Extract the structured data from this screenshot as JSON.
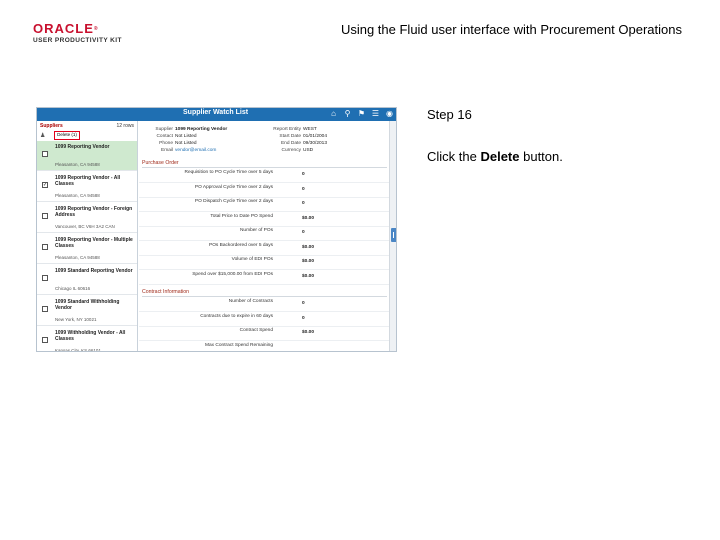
{
  "header": {
    "logo_word": "ORACLE",
    "logo_mark": "®",
    "logo_sub": "USER PRODUCTIVITY KIT",
    "title": "Using the Fluid user interface with Procurement Operations"
  },
  "instructions": {
    "step": "Step 16",
    "prefix": "Click the ",
    "action": "Delete",
    "suffix": " button."
  },
  "screenshot": {
    "window_title": "Supplier Watch List",
    "bar_icons": [
      "home-icon",
      "search-icon",
      "flag-icon",
      "menu-icon",
      "navbar-icon"
    ],
    "sidebar": {
      "header_label": "Suppliers",
      "count": "12 rows",
      "delete_button": "Delete (1)",
      "vendors": [
        {
          "name": "1099 Reporting Vendor",
          "address": "Pleasanton, CA 94588",
          "checked": false,
          "selected": true
        },
        {
          "name": "1099 Reporting Vendor - All Classes",
          "address": "Pleasanton, CA 94588",
          "checked": true,
          "selected": false
        },
        {
          "name": "1099 Reporting Vendor - Foreign Address",
          "address": "Vancouver, BC V6H 3A2 CAN",
          "checked": false,
          "selected": false
        },
        {
          "name": "1099 Reporting Vendor - Multiple Classes",
          "address": "Pleasanton, CA 94588",
          "checked": false,
          "selected": false
        },
        {
          "name": "1099 Standard Reporting Vendor",
          "address": "Chicago IL 60616",
          "checked": false,
          "selected": false
        },
        {
          "name": "1099 Standard Withholding Vendor",
          "address": "New York, NY 10021",
          "checked": false,
          "selected": false
        },
        {
          "name": "1099 Withholding Vendor - All Classes",
          "address": "Kansas City, KS 66101",
          "checked": false,
          "selected": false
        }
      ]
    },
    "detail": {
      "left_info": [
        {
          "k": "Supplier",
          "v": "1099 Reporting Vendor",
          "style": "hl"
        },
        {
          "k": "Contact",
          "v": "Not Listed",
          "style": ""
        },
        {
          "k": "Phone",
          "v": "Not Listed",
          "style": ""
        },
        {
          "k": "Email",
          "v": "vendor@email.com",
          "style": "link"
        }
      ],
      "right_info": [
        {
          "k": "Report Entity",
          "v": "WEST"
        },
        {
          "k": "Start Date",
          "v": "01/01/2004"
        },
        {
          "k": "End Date",
          "v": "09/30/2013"
        },
        {
          "k": "Currency",
          "v": "USD"
        }
      ],
      "purchase_section": "Purchase Order",
      "purchase_metrics": [
        {
          "label": "Requisition to PO Cycle Time over 5 days",
          "value": "0"
        },
        {
          "label": "PO Approval Cycle Time over 2 days",
          "value": "0"
        },
        {
          "label": "PO Dispatch Cycle Time over 2 days",
          "value": "0"
        },
        {
          "label": "Total Price to Date PO Spend",
          "value": "$0.00"
        },
        {
          "label": "Number of POs",
          "value": "0"
        },
        {
          "label": "POs Backordered over 5 days",
          "value": "$0.00"
        },
        {
          "label": "Volume of EDI POs",
          "value": "$0.00"
        },
        {
          "label": "Spend over $15,000.00 from EDI POs",
          "value": "$0.00"
        }
      ],
      "contract_section": "Contract Information",
      "contract_metrics": [
        {
          "label": "Number of Contracts",
          "value": "0"
        },
        {
          "label": "Contracts due to expire in 60 days",
          "value": "0"
        },
        {
          "label": "Contract Spend",
          "value": "$0.00"
        },
        {
          "label": "Max Contract Spend Remaining",
          "value": ""
        }
      ]
    }
  }
}
